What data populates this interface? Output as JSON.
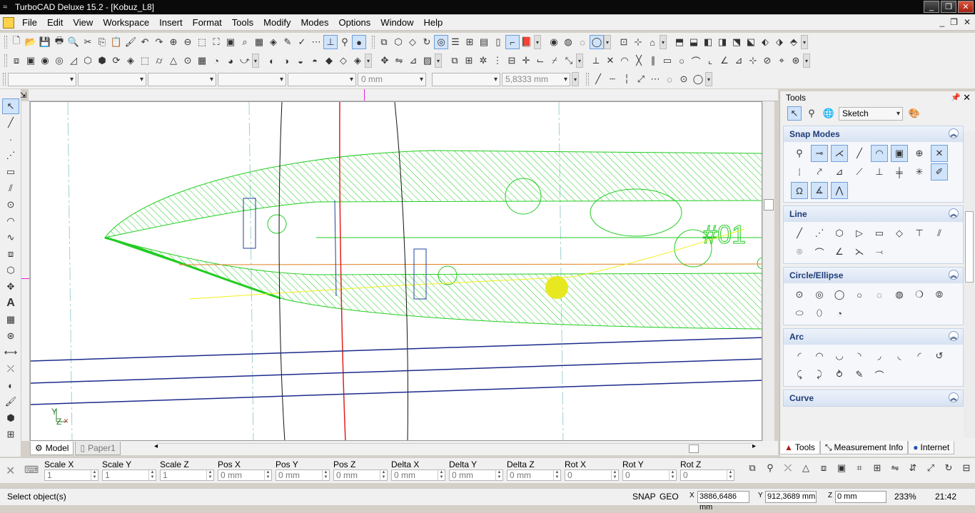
{
  "window": {
    "title": "TurboCAD Deluxe 15.2 - [Kobuz_L8]"
  },
  "menu": {
    "items": [
      "File",
      "Edit",
      "View",
      "Workspace",
      "Insert",
      "Format",
      "Tools",
      "Modify",
      "Modes",
      "Options",
      "Window",
      "Help"
    ]
  },
  "property_bar": {
    "width_value": "0 mm",
    "height_value": "5,8333 mm"
  },
  "canvas": {
    "annotation": "#01",
    "axis_label_y": "Y",
    "axis_label_z": "Z"
  },
  "tabs": {
    "model": "Model",
    "paper": "Paper1"
  },
  "tools_dock": {
    "title": "Tools",
    "palette_select": "Sketch",
    "panels": [
      "Snap Modes",
      "Line",
      "Circle/Ellipse",
      "Arc",
      "Curve"
    ],
    "bottom_tabs": [
      "Tools",
      "Measurement Info",
      "Internet"
    ]
  },
  "inspector": {
    "fields": [
      {
        "label": "Scale X",
        "value": "1"
      },
      {
        "label": "Scale Y",
        "value": "1"
      },
      {
        "label": "Scale Z",
        "value": "1"
      },
      {
        "label": "Pos X",
        "value": "0 mm"
      },
      {
        "label": "Pos Y",
        "value": "0 mm"
      },
      {
        "label": "Pos Z",
        "value": "0 mm"
      },
      {
        "label": "Delta X",
        "value": "0 mm"
      },
      {
        "label": "Delta Y",
        "value": "0 mm"
      },
      {
        "label": "Delta Z",
        "value": "0 mm"
      },
      {
        "label": "Rot X",
        "value": "0"
      },
      {
        "label": "Rot Y",
        "value": "0"
      },
      {
        "label": "Rot Z",
        "value": "0"
      }
    ]
  },
  "status": {
    "message": "Select object(s)",
    "snap": "SNAP",
    "geo": "GEO",
    "x": "3886,6486 mm",
    "y": "912,3689 mm",
    "z": "0 mm",
    "zoom": "233%",
    "time": "21:42"
  },
  "colors": {
    "accent": "#1e3c78",
    "hatch": "#22cc22",
    "titlebar": "#0a0a0a"
  }
}
